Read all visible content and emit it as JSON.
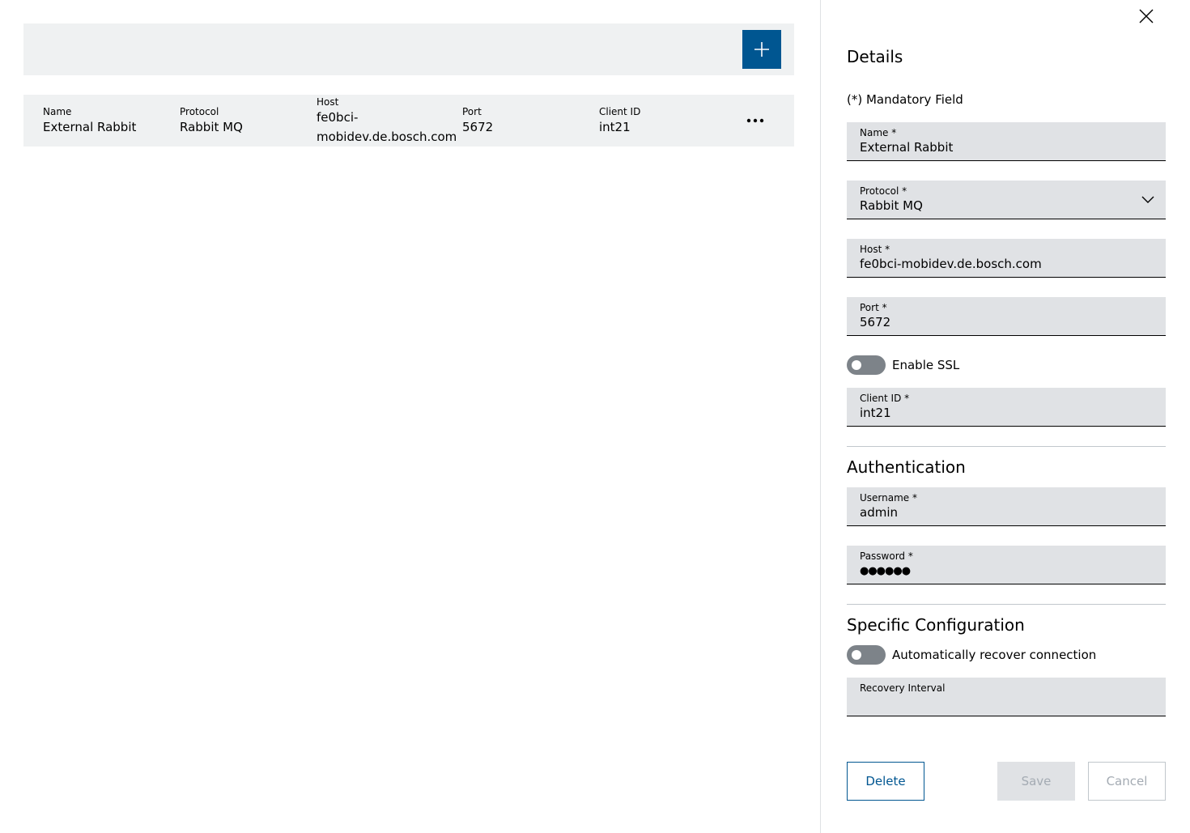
{
  "main": {
    "add_button_icon": "plus-icon",
    "table": {
      "columns": [
        "Name",
        "Protocol",
        "Host",
        "Port",
        "Client ID"
      ],
      "rows": [
        {
          "name": "External Rabbit",
          "protocol": "Rabbit MQ",
          "host_line1": "fe0bci-",
          "host_line2": "mobidev.de.bosch.com",
          "port": "5672",
          "client_id": "int21"
        }
      ],
      "more_icon": "more-horizontal-icon"
    }
  },
  "panel": {
    "close_icon": "close-icon",
    "title": "Details",
    "mandatory_note": "(*) Mandatory Field",
    "fields": {
      "name": {
        "label": "Name *",
        "value": "External Rabbit"
      },
      "protocol": {
        "label": "Protocol *",
        "value": "Rabbit MQ"
      },
      "host": {
        "label": "Host *",
        "value": "fe0bci-mobidev.de.bosch.com"
      },
      "port": {
        "label": "Port *",
        "value": "5672"
      },
      "client_id": {
        "label": "Client ID *",
        "value": "int21"
      }
    },
    "enable_ssl": {
      "label": "Enable SSL",
      "checked": false
    },
    "authentication": {
      "title": "Authentication",
      "username": {
        "label": "Username *",
        "value": "admin"
      },
      "password": {
        "label": "Password *",
        "value": "●●●●●●"
      }
    },
    "specific": {
      "title": "Specific Configuration",
      "auto_recover": {
        "label": "Automatically recover connection",
        "checked": false
      },
      "recovery_interval": {
        "label": "Recovery Interval",
        "value": ""
      }
    },
    "buttons": {
      "delete": "Delete",
      "save": "Save",
      "cancel": "Cancel"
    }
  },
  "colors": {
    "primary": "#005691",
    "surface": "#eff1f2",
    "field_bg": "#e0e2e5",
    "toggle_off": "#7d8389",
    "disabled_text": "#a4abb3"
  }
}
